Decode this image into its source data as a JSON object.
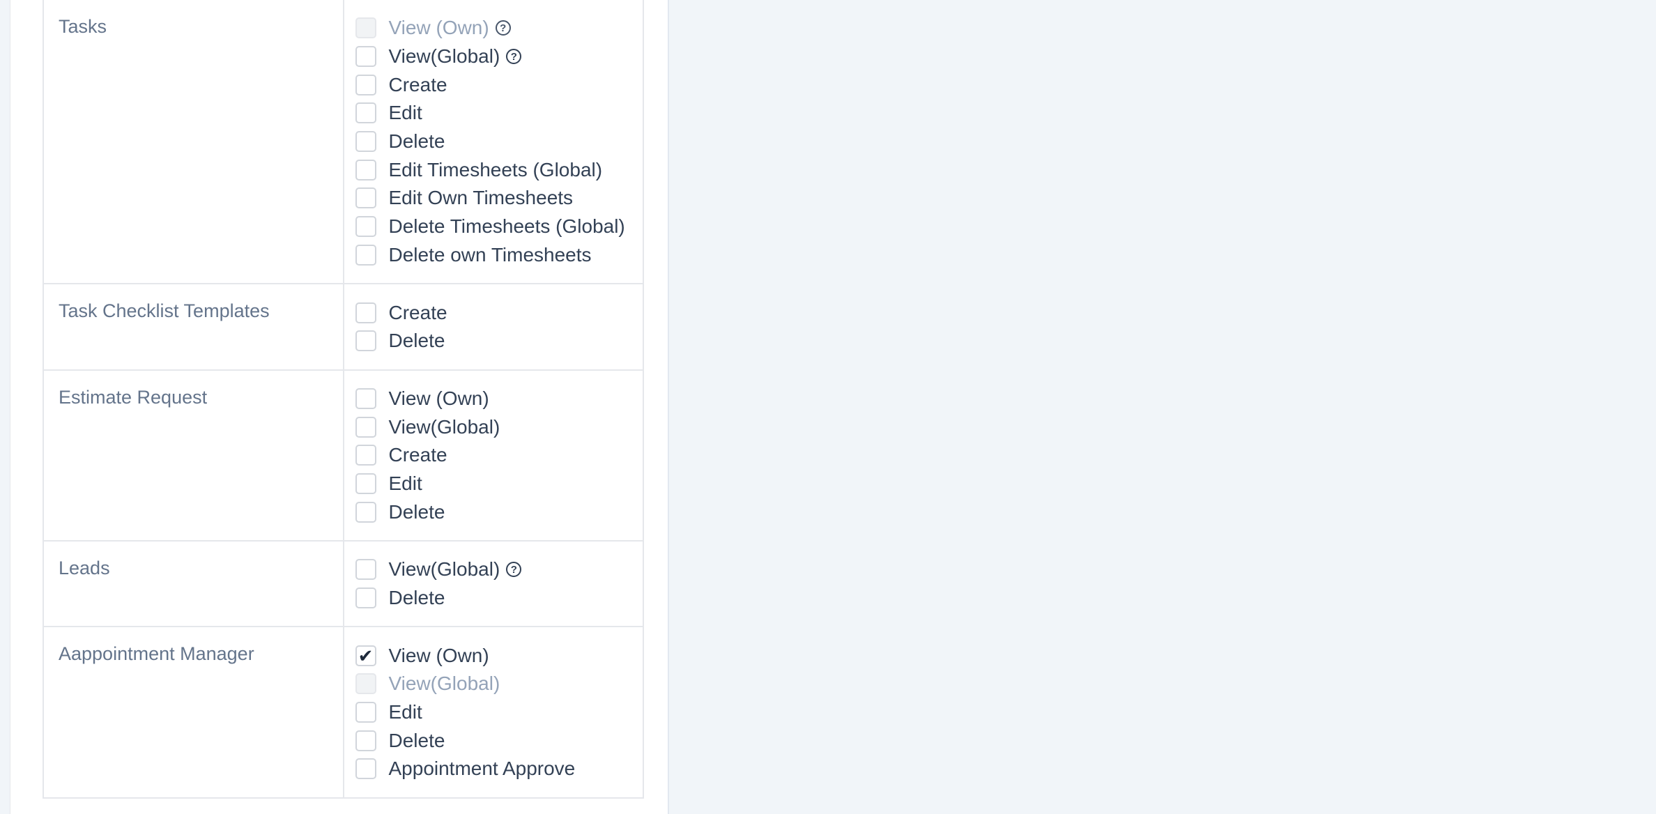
{
  "permissions": {
    "rows": [
      {
        "feature": "Tasks",
        "capabilities": [
          {
            "label": "View (Own)",
            "checked": false,
            "disabled": true,
            "help": "question-circle-icon"
          },
          {
            "label": "View(Global)",
            "checked": false,
            "disabled": false,
            "help": "question-circle-icon"
          },
          {
            "label": "Create",
            "checked": false,
            "disabled": false
          },
          {
            "label": "Edit",
            "checked": false,
            "disabled": false
          },
          {
            "label": "Delete",
            "checked": false,
            "disabled": false
          },
          {
            "label": "Edit Timesheets (Global)",
            "checked": false,
            "disabled": false
          },
          {
            "label": "Edit Own Timesheets",
            "checked": false,
            "disabled": false
          },
          {
            "label": "Delete Timesheets (Global)",
            "checked": false,
            "disabled": false
          },
          {
            "label": "Delete own Timesheets",
            "checked": false,
            "disabled": false
          }
        ]
      },
      {
        "feature": "Task Checklist Templates",
        "capabilities": [
          {
            "label": "Create",
            "checked": false,
            "disabled": false
          },
          {
            "label": "Delete",
            "checked": false,
            "disabled": false
          }
        ]
      },
      {
        "feature": "Estimate Request",
        "capabilities": [
          {
            "label": "View (Own)",
            "checked": false,
            "disabled": false
          },
          {
            "label": "View(Global)",
            "checked": false,
            "disabled": false
          },
          {
            "label": "Create",
            "checked": false,
            "disabled": false
          },
          {
            "label": "Edit",
            "checked": false,
            "disabled": false
          },
          {
            "label": "Delete",
            "checked": false,
            "disabled": false
          }
        ]
      },
      {
        "feature": "Leads",
        "capabilities": [
          {
            "label": "View(Global)",
            "checked": false,
            "disabled": false,
            "help": "question-circle-icon"
          },
          {
            "label": "Delete",
            "checked": false,
            "disabled": false
          }
        ]
      },
      {
        "feature": "Aappointment Manager",
        "capabilities": [
          {
            "label": "View (Own)",
            "checked": true,
            "disabled": false
          },
          {
            "label": "View(Global)",
            "checked": false,
            "disabled": true
          },
          {
            "label": "Edit",
            "checked": false,
            "disabled": false
          },
          {
            "label": "Delete",
            "checked": false,
            "disabled": false
          },
          {
            "label": "Appointment Approve",
            "checked": false,
            "disabled": false
          }
        ]
      }
    ]
  },
  "icons": {
    "check_glyph": "✔",
    "help_glyph": "?"
  },
  "colors": {
    "page_background": "#f1f5f9",
    "panel_background": "#ffffff",
    "border": "#e5e7eb",
    "feature_text": "#64748b",
    "capability_text": "#334155",
    "disabled_text": "#94a3b8"
  }
}
